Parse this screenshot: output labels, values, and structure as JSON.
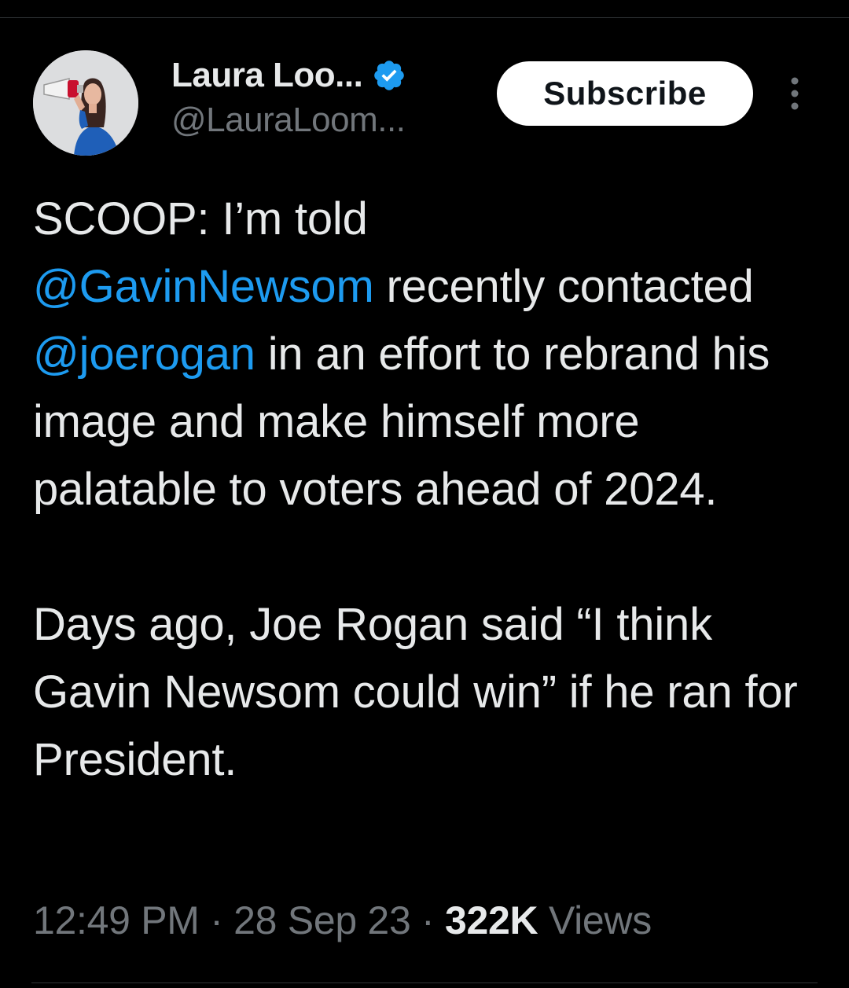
{
  "author": {
    "display_name": "Laura Loo...",
    "handle": "@LauraLoom...",
    "verified_color": "#1d9bf0",
    "avatar_icon": "profile-photo-with-megaphone"
  },
  "subscribe_label": "Subscribe",
  "more_icon": "vertical-ellipsis-icon",
  "tweet": {
    "p1_a": "SCOOP: I’m told",
    "mention_1": "@GavinNewsom",
    "p1_b": " recently contacted ",
    "mention_2": "@joerogan",
    "p1_c": " in an effort to rebrand his image and make himself more palatable to voters ahead of 2024.",
    "p2": "Days ago, Joe Rogan said “I think Gavin Newsom could win” if he ran for President."
  },
  "meta": {
    "time": "12:49 PM",
    "separator": "·",
    "date": "28 Sep 23",
    "views_count": "322K",
    "views_label": "Views"
  },
  "colors": {
    "background": "#000000",
    "text": "#e7e9ea",
    "secondary": "#71767b",
    "link": "#1d9bf0"
  }
}
